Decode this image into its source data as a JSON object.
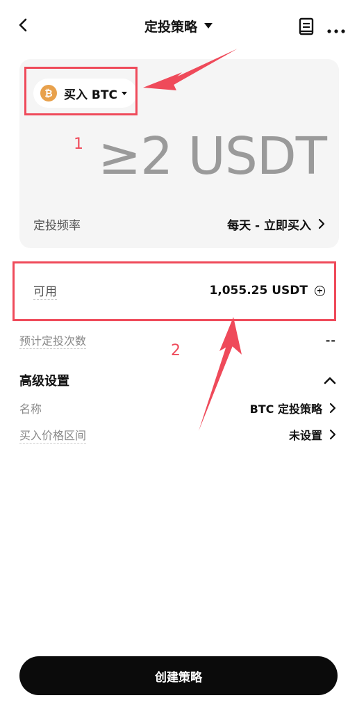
{
  "header": {
    "title": "定投策略",
    "back_icon": "chevron-left-icon",
    "doc_icon": "document-icon",
    "more_icon": "more-icon"
  },
  "card": {
    "asset_label": "买入 BTC",
    "coin_symbol": "₿",
    "amount_placeholder": "≥2 USDT",
    "frequency_label": "定投频率",
    "frequency_value": "每天 - 立即买入"
  },
  "available": {
    "label": "可用",
    "value": "1,055.25 USDT"
  },
  "estimated": {
    "label": "预计定投次数",
    "value": "--"
  },
  "advanced": {
    "title": "高级设置",
    "name_label": "名称",
    "name_value": "BTC 定投策略",
    "price_label": "买入价格区间",
    "price_value": "未设置"
  },
  "annotations": {
    "note1": "1",
    "note2": "2",
    "color": "#ef4a5a"
  },
  "cta": {
    "label": "创建策略"
  },
  "colors": {
    "accent": "#0b0b0b",
    "btc": "#e8a14c",
    "card_bg": "#f5f5f5"
  }
}
